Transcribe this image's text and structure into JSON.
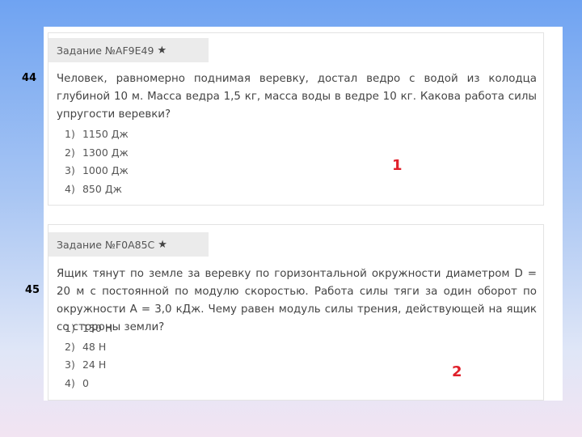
{
  "q1": {
    "number": "44",
    "header": "Задание №AF9E49",
    "question": "Человек, равномерно поднимая веревку, достал ведро с водой из колодца глубиной 10 м. Масса ведра 1,5 кг, масса воды в ведре 10 кг. Какова работа силы упругости веревки?",
    "options": [
      {
        "num": "1)",
        "text": "1150 Дж"
      },
      {
        "num": "2)",
        "text": "1300 Дж"
      },
      {
        "num": "3)",
        "text": "1000 Дж"
      },
      {
        "num": "4)",
        "text": "850 Дж"
      }
    ],
    "answer": "1"
  },
  "q2": {
    "number": "45",
    "header": "Задание №F0A85C",
    "question": "Ящик тянут по земле за веревку по горизонтальной окружности диаметром D = 20 м с постоянной по модулю скоростью. Работа силы тяги за один оборот по окружности A = 3,0 кДж. Чему равен модуль силы трения, действующей на ящик со стороны земли?",
    "options": [
      {
        "num": "1)",
        "text": "150 Н"
      },
      {
        "num": "2)",
        "text": "48 Н"
      },
      {
        "num": "3)",
        "text": "24 Н"
      },
      {
        "num": "4)",
        "text": "0"
      }
    ],
    "answer": "2"
  },
  "star": "★"
}
